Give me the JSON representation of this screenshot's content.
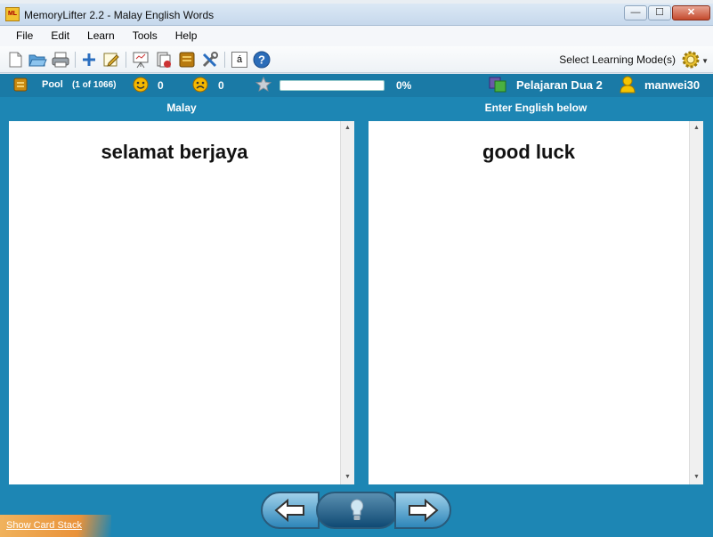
{
  "window": {
    "title": "MemoryLifter 2.2 - Malay English Words",
    "app_icon_text": "ML",
    "minimize_glyph": "—",
    "maximize_glyph": "☐",
    "close_glyph": "✕"
  },
  "menu": [
    "File",
    "Edit",
    "Learn",
    "Tools",
    "Help"
  ],
  "toolbar": {
    "learning_mode_label": "Select Learning Mode(s)",
    "special_char_label": "á"
  },
  "status": {
    "pool_label": "Pool",
    "pool_count": "(1 of 1066)",
    "correct_count": "0",
    "wrong_count": "0",
    "progress_fraction": 0,
    "progress_percent": "0%",
    "lesson_name": "Pelajaran Dua 2",
    "user_name": "manwei30"
  },
  "question": {
    "header": "Malay",
    "text": "selamat berjaya"
  },
  "answer": {
    "header": "Enter English below",
    "text": "good luck"
  },
  "footer": {
    "show_card_stack_label": "Show Card Stack"
  },
  "colors": {
    "main_blue": "#1d86b4",
    "status_blue": "#1a7aa6",
    "accent_orange": "#e9923a"
  }
}
